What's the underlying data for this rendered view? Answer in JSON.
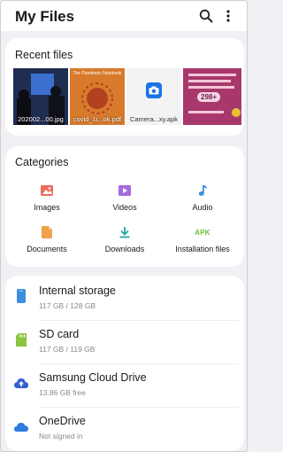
{
  "app": {
    "title": "My Files"
  },
  "header": {
    "search_icon": "search-icon",
    "more_icon": "more-vert-icon"
  },
  "recent": {
    "title": "Recent files",
    "items": [
      {
        "caption": "202002...00.jpg"
      },
      {
        "caption": "covid_1i...ok.pdf",
        "thumb_text": "The Pandemic Notebook"
      },
      {
        "caption": "Camera...xy.apk"
      },
      {
        "caption": "",
        "thumb_text": "298+"
      }
    ]
  },
  "categories": {
    "title": "Categories",
    "items": [
      {
        "label": "Images",
        "icon": "image-icon",
        "color": "#ec6b5a"
      },
      {
        "label": "Videos",
        "icon": "video-icon",
        "color": "#a56bdc"
      },
      {
        "label": "Audio",
        "icon": "audio-icon",
        "color": "#3e8fe0"
      },
      {
        "label": "Documents",
        "icon": "document-icon",
        "color": "#f0a24a"
      },
      {
        "label": "Downloads",
        "icon": "download-icon",
        "color": "#22a8a0"
      },
      {
        "label": "Installation files",
        "icon": "apk-icon",
        "color": "#6cbf3a",
        "icon_text": "APK"
      }
    ]
  },
  "storage": {
    "items": [
      {
        "name": "Internal storage",
        "detail": "117 GB / 128 GB",
        "icon": "phone-icon",
        "color": "#3e8fe0"
      },
      {
        "name": "SD card",
        "detail": "117 GB / 119 GB",
        "icon": "sd-card-icon",
        "color": "#8cc43e"
      },
      {
        "name": "Samsung Cloud Drive",
        "detail": "13.86 GB free",
        "icon": "cloud-upload-icon",
        "color": "#2f5fd0"
      },
      {
        "name": "OneDrive",
        "detail": "Not signed in",
        "icon": "onedrive-icon",
        "color": "#2d7be0"
      }
    ]
  }
}
